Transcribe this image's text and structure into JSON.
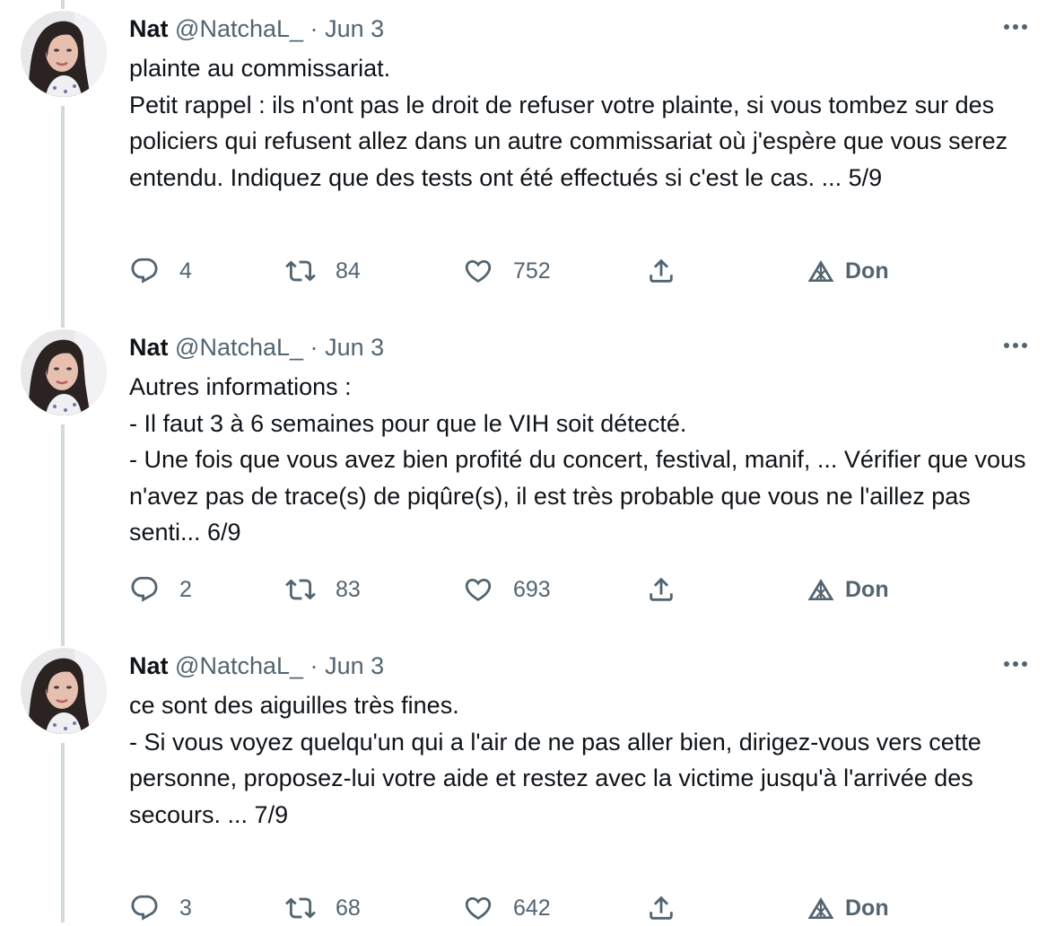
{
  "tweets": [
    {
      "author_name": "Nat",
      "handle": "@NatchaL_",
      "separator": "·",
      "date": "Jun 3",
      "lines": [
        "plainte au commissariat.",
        "Petit rappel : ils n'ont pas le droit de refuser votre plainte, si vous tombez sur des policiers qui refusent allez dans un autre commissariat où j'espère que vous serez entendu. Indiquez que des tests ont été effectués si c'est le cas. ... 5/9"
      ],
      "replies": "4",
      "retweets": "84",
      "likes": "752",
      "don_label": "Don"
    },
    {
      "author_name": "Nat",
      "handle": "@NatchaL_",
      "separator": "·",
      "date": "Jun 3",
      "lines": [
        "Autres informations :",
        "- Il faut 3 à 6 semaines pour que le VIH soit détecté.",
        "- Une fois que vous avez bien profité du concert, festival, manif, ... Vérifier que vous n'avez pas de trace(s) de piqûre(s), il est très probable que vous ne l'aillez pas senti... 6/9"
      ],
      "replies": "2",
      "retweets": "83",
      "likes": "693",
      "don_label": "Don"
    },
    {
      "author_name": "Nat",
      "handle": "@NatchaL_",
      "separator": "·",
      "date": "Jun 3",
      "lines": [
        "ce sont des aiguilles très fines.",
        "- Si vous voyez quelqu'un qui a l'air de ne pas aller bien, dirigez-vous vers cette personne, proposez-lui votre aide et restez avec la victime jusqu'à l'arrivée des secours. ... 7/9"
      ],
      "replies": "3",
      "retweets": "68",
      "likes": "642",
      "don_label": "Don"
    }
  ],
  "colors": {
    "text": "#0f1419",
    "secondary": "#536471",
    "thread_line": "#cfd9de"
  },
  "icons": [
    "reply-icon",
    "retweet-icon",
    "like-icon",
    "share-icon",
    "tip-icon",
    "more-icon"
  ]
}
